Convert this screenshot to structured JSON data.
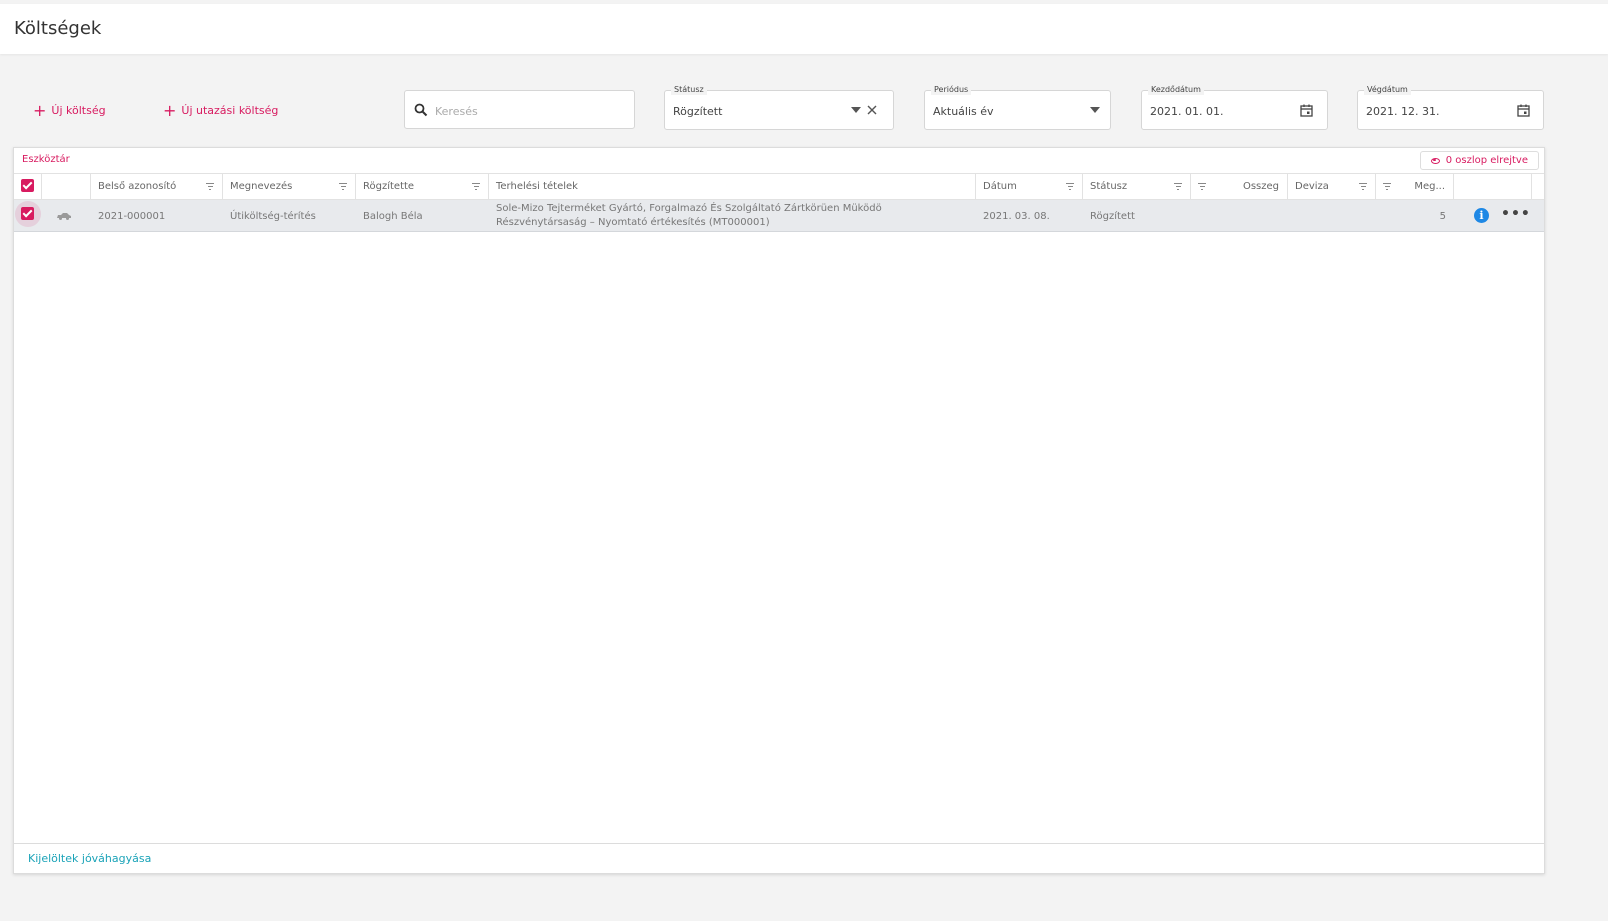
{
  "page": {
    "title": "Költségek"
  },
  "actions": {
    "new_cost": {
      "icon": "plus-icon",
      "label": "Új költség"
    },
    "new_travel_cost": {
      "icon": "plus-icon",
      "label": "Új utazási költség"
    }
  },
  "filters": {
    "search": {
      "placeholder": "Keresés",
      "value": ""
    },
    "status": {
      "label": "Státusz",
      "value": "Rögzített"
    },
    "period": {
      "label": "Periódus",
      "value": "Aktuális év"
    },
    "start_date": {
      "label": "Kezdődátum",
      "value": "2021. 01. 01."
    },
    "end_date": {
      "label": "Végdátum",
      "value": "2021. 12. 31."
    }
  },
  "grid": {
    "toolbar_label": "Eszköztár",
    "hidden_columns_label": "0 oszlop elrejtve",
    "columns": {
      "internal_id": "Belső azonosító",
      "name": "Megnevezés",
      "recorded_by": "Rögzítette",
      "charge_items": "Terhelési tételek",
      "date": "Dátum",
      "status": "Státusz",
      "amount": "Összeg",
      "currency": "Deviza",
      "meg": "Meg..."
    },
    "rows": [
      {
        "type_icon": "car-icon",
        "internal_id": "2021-000001",
        "name": "Útiköltség-térítés",
        "recorded_by": "Balogh Béla",
        "charge_items": "Sole-Mizo Tejterméket Gyártó, Forgalmazó És Szolgáltató Zártkörüen Müködö Részvénytársaság – Nyomtató értékesítés (MT000001)",
        "date": "2021. 03. 08.",
        "status": "Rögzített",
        "amount": "",
        "currency": "",
        "meg": "5"
      }
    ],
    "footer_action": "Kijelöltek jóváhagyása"
  },
  "colors": {
    "accent": "#d81b60",
    "link": "#1aa3b8",
    "info": "#1e88e5"
  }
}
